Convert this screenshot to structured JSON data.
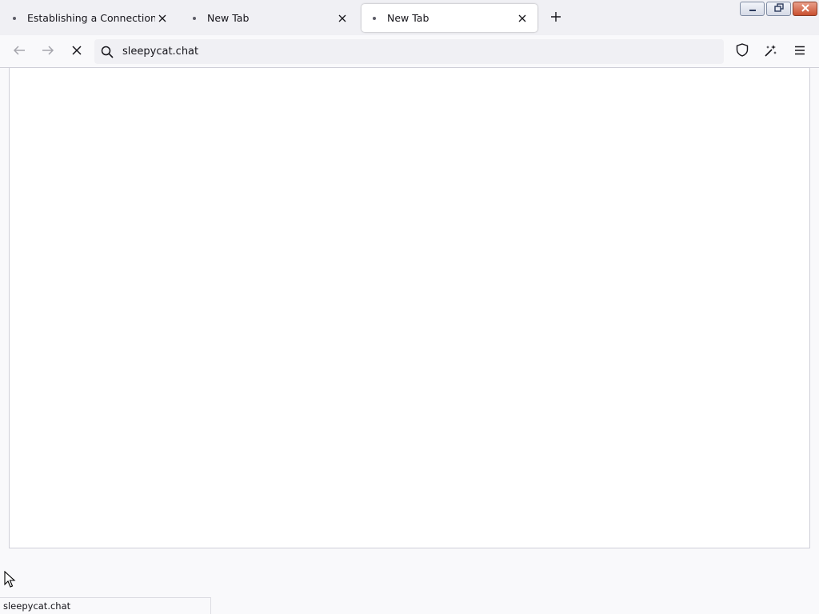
{
  "tabs": [
    {
      "title": "Establishing a Connection",
      "selected": false
    },
    {
      "title": "New Tab",
      "selected": false
    },
    {
      "title": "New Tab",
      "selected": true
    }
  ],
  "toolbar": {
    "new_tab_icon": "plus-icon",
    "back_icon": "arrow-left-icon",
    "forward_icon": "arrow-right-icon",
    "stop_icon": "stop-x-icon",
    "tracking_protection_icon": "shield-icon",
    "extensions_icon": "sparkle-icon",
    "menu_icon": "hamburger-icon"
  },
  "urlbar": {
    "value": "sleepycat.chat",
    "search_icon": "search-icon"
  },
  "status": {
    "text": "sleepycat.chat"
  },
  "colors": {
    "tabstrip_bg": "#f0f0f4",
    "toolbar_bg": "#f9f9fb",
    "selected_tab_bg": "#ffffff",
    "close_button": "#c9502f"
  }
}
